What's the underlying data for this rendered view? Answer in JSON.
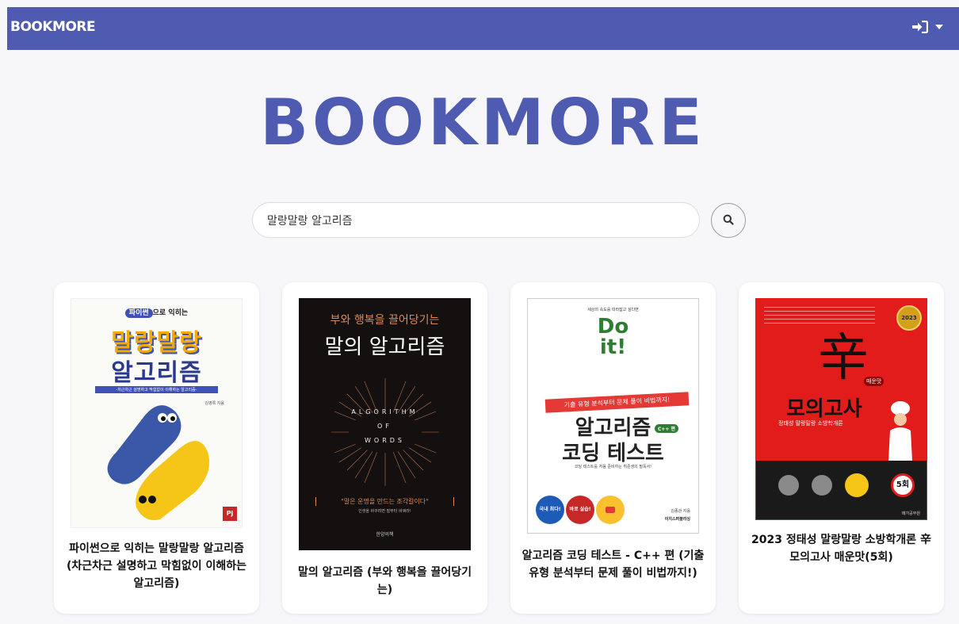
{
  "navbar": {
    "brand": "BOOKMORE",
    "login_icon": "sign-in-icon",
    "dropdown_icon": "caret-down-icon"
  },
  "hero": {
    "logo": "BOOKMORE"
  },
  "search": {
    "value": "말랑말랑 알고리즘",
    "button_icon": "search-icon"
  },
  "colors": {
    "brand": "#4f5bb1",
    "background": "#f7f7fa"
  },
  "books": [
    {
      "title": "파이썬으로 익히는 말랑말랑 알고리즘 (차근차근 설명하고 막힘없이 이해하는 알고리즘)",
      "cover": {
        "top_label": "파이썬",
        "top_label_suffix": "으로 익히는",
        "title_line1": "말랑말랑",
        "title_line2": "알고리즘",
        "subtitle": "-차근차근 설명하고 막힘없이 이해하는 알고리즘-",
        "author": "김영록 지음"
      }
    },
    {
      "title": "말의 알고리즘 (부와 행복을 끌어당기는)",
      "cover": {
        "top_line": "부와 행복을 끌어당기는",
        "title": "말의 알고리즘",
        "center_text_1": "ALGORITHM",
        "center_text_2": "OF",
        "center_text_3": "WORDS",
        "quote": "\"말은 운명을 만드는 조각칼이다\"",
        "quote_sub": "인생을 바꾸려면 말부터 바꿔라!",
        "publisher": "한양의책"
      }
    },
    {
      "title": "알고리즘 코딩 테스트 - C++ 편 (기출 유형 분석부터 문제 풀이 비법까지!)",
      "cover": {
        "small_top": "세상의 속도를 따라잡고 싶다면",
        "brand_line1": "Do",
        "brand_line2": "it!",
        "ribbon": "기출 유형 분석부터 문제 풀이 비법까지!",
        "title_line1": "알고리즘",
        "title_line2": "코딩 테스트",
        "badge": "C++ 편",
        "desc": "코딩 테스트를 처음 준비하는 취준생의 필독서!",
        "circle1": "국내 최다!",
        "circle2": "바로 실습!",
        "author": "김종관 지음",
        "publisher": "이지스퍼블리싱"
      }
    },
    {
      "title": "2023 정태성 말랑말랑 소방학개론 辛모의고사 매운맛(5회)",
      "cover": {
        "big_char": "辛",
        "spicy": "매운맛",
        "title": "모의고사",
        "subtitle": "정태성 말랑말랑 소방학개론",
        "year_badge": "2023",
        "count_badge": "5회",
        "publisher": "메가공무원"
      }
    }
  ]
}
